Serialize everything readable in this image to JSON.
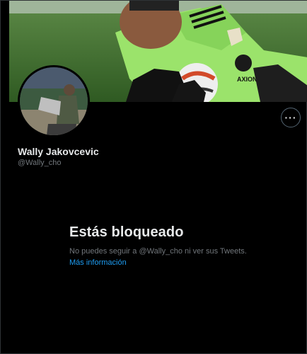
{
  "profile": {
    "display_name": "Wally Jakovcevic",
    "handle": "@Wally_cho",
    "more_button_label": "···",
    "banner_brand": "AXION"
  },
  "blocked": {
    "title": "Estás bloqueado",
    "description": "No puedes seguir a @Wally_cho ni ver sus Tweets.",
    "link_label": "Más información"
  },
  "colors": {
    "background": "#000000",
    "text_primary": "#e7e9ea",
    "text_secondary": "#71767b",
    "link": "#1d9bf0"
  }
}
